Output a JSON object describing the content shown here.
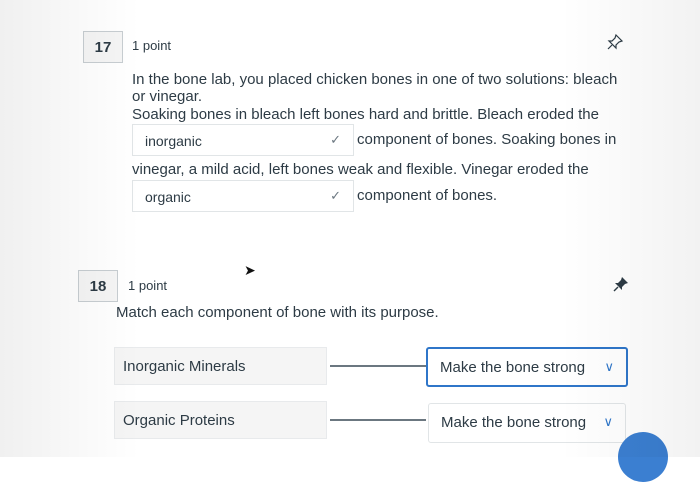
{
  "q17": {
    "number": "17",
    "points": "1 point",
    "pin_icon": "pin-outline",
    "line1": "In the bone lab, you placed chicken bones in one of two solutions: bleach",
    "line2": "or vinegar.",
    "line3": "Soaking bones in bleach left bones hard and brittle. Bleach eroded the",
    "dropdown1": {
      "value": "inorganic"
    },
    "after_dropdown1": "component of bones. Soaking bones in",
    "line5": "vinegar, a mild acid, left bones weak and flexible. Vinegar eroded the",
    "dropdown2": {
      "value": "organic"
    },
    "after_dropdown2": "component of bones."
  },
  "q18": {
    "number": "18",
    "points": "1 point",
    "pin_icon": "pin-filled",
    "prompt": "Match each component of bone with its purpose.",
    "rows": [
      {
        "label": "Inorganic Minerals",
        "selected": "Make the bone strong"
      },
      {
        "label": "Organic Proteins",
        "selected": "Make the bone strong"
      }
    ]
  },
  "colors": {
    "accent": "#2f76c9",
    "text": "#2d3b45"
  }
}
